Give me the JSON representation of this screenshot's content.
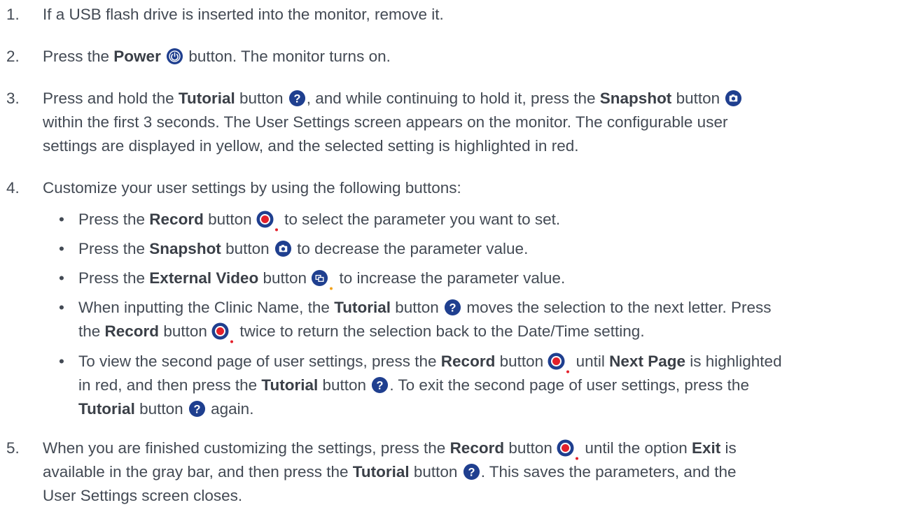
{
  "steps": [
    {
      "num": "1.",
      "text": "If a USB flash drive is inserted into the monitor, remove it."
    },
    {
      "num": "2.",
      "t1": "Press the ",
      "b1": "Power",
      "t2": " button. The monitor turns on."
    },
    {
      "num": "3.",
      "t1": "Press and hold the ",
      "b1": "Tutorial",
      "t2": " button ",
      "t3": ", and while continuing to hold it, press the ",
      "b2": "Snapshot",
      "t4": " button",
      "line2": "within the first 3 seconds. The User Settings screen appears on the monitor. The configurable user",
      "line3": "settings are displayed in yellow, and the selected setting is highlighted in red."
    },
    {
      "num": "4.",
      "text": "Customize your user settings by using the following buttons:"
    },
    {
      "num": "5.",
      "t1": "When you are finished customizing the settings, press the ",
      "b1": "Record",
      "t2": " button ",
      "t3": " until the option ",
      "b2": "Exit",
      "t4": " is",
      "line2a": "available in the gray bar, and then press the ",
      "line2b": "Tutorial",
      "line2c": " button ",
      "line2d": ". This saves the parameters, and the",
      "line3": "User Settings screen closes."
    }
  ],
  "bullets": [
    {
      "t1": "Press the ",
      "b1": "Record",
      "t2": " button ",
      "t3": " to select the parameter you want to set."
    },
    {
      "t1": "Press the ",
      "b1": "Snapshot",
      "t2": " button ",
      "t3": " to decrease the parameter value."
    },
    {
      "t1": "Press the ",
      "b1": "External Video",
      "t2": " button ",
      "t3": " to increase the parameter value."
    },
    {
      "t1": "When inputting the Clinic Name, the ",
      "b1": "Tutorial",
      "t2": " button ",
      "t3": " moves the selection to the next letter. Press",
      "l2a": "the ",
      "l2b": "Record",
      "l2c": " button ",
      "l2d": " twice to return the selection back to the Date/Time setting."
    },
    {
      "t1": "To view the second page of user settings, press the ",
      "b1": "Record",
      "t2": " button ",
      "t3": " until ",
      "b2": "Next Page",
      "t4": " is highlighted",
      "l2a": "in red, and then press the ",
      "l2b": "Tutorial",
      "l2c": " button ",
      "l2d": ". To exit the second page of user settings, press the",
      "l3a": "Tutorial",
      "l3b": " button ",
      "l3c": " again."
    }
  ],
  "bullet_char": "•",
  "icons": {
    "power": "power-icon",
    "tutorial": "question-icon",
    "snapshot": "camera-icon",
    "record": "record-icon",
    "external_video": "external-video-icon"
  },
  "colors": {
    "text": "#434a54",
    "icon_blue": "#1f3f8f",
    "record_red": "#e4202a",
    "external_dot": "#f2a21b"
  }
}
